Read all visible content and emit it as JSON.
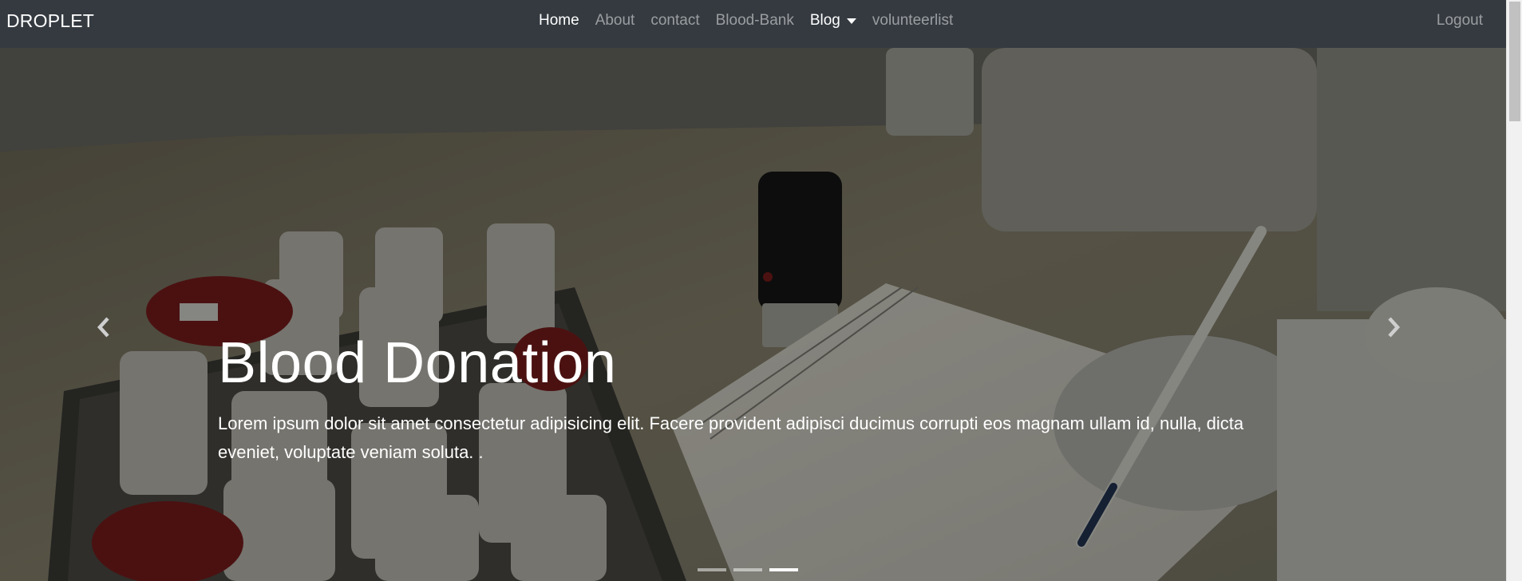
{
  "navbar": {
    "brand": "DROPLET",
    "links": [
      "Home",
      "About",
      "contact",
      "Blood-Bank",
      "Blog",
      "volunteerlist"
    ],
    "active": "Home",
    "logout": "Logout"
  },
  "hero": {
    "title": "Blood Donation",
    "text": "Lorem ipsum dolor sit amet consectetur adipisicing elit. Facere provident adipisci ducimus corrupti eos magnam ullam id, nulla, dicta eveniet, voluptate veniam soluta. .",
    "slide_count": 3,
    "active_slide": 3
  },
  "colors": {
    "navbar_bg": "#343a40",
    "link_active": "#ffffff",
    "link_muted": "rgba(255,255,255,0.5)"
  },
  "icons": {
    "prev": "chevron-left-icon",
    "next": "chevron-right-icon",
    "dropdown": "caret-down-icon"
  }
}
